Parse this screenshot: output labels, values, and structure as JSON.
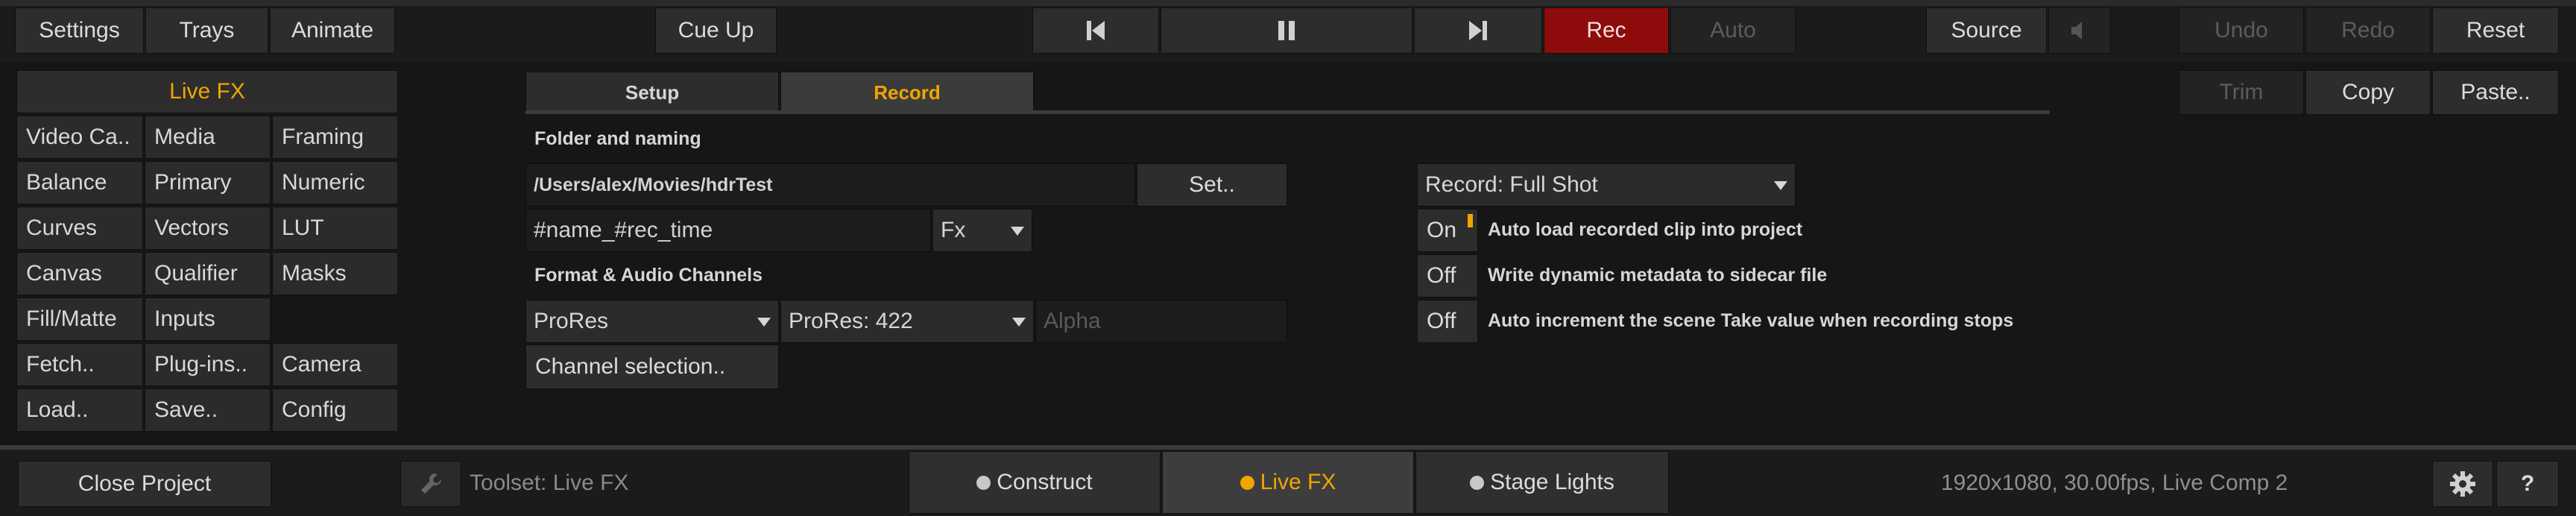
{
  "top_menu": {
    "settings": "Settings",
    "trays": "Trays",
    "animate": "Animate",
    "cue_up": "Cue Up",
    "rec": "Rec",
    "auto": "Auto",
    "source": "Source",
    "undo": "Undo",
    "redo": "Redo",
    "reset": "Reset"
  },
  "edit_buttons": {
    "trim": "Trim",
    "copy": "Copy",
    "paste": "Paste.."
  },
  "tool_grid": {
    "header": "Live FX",
    "rows": [
      [
        "Video Ca..",
        "Media",
        "Framing"
      ],
      [
        "Balance",
        "Primary",
        "Numeric"
      ],
      [
        "Curves",
        "Vectors",
        "LUT"
      ],
      [
        "Canvas",
        "Qualifier",
        "Masks"
      ],
      [
        "Fill/Matte",
        "Inputs",
        ""
      ],
      [
        "Fetch..",
        "Plug-ins..",
        "Camera"
      ],
      [
        "Load..",
        "Save..",
        "Config"
      ]
    ]
  },
  "panel": {
    "tabs": [
      "Setup",
      "Record"
    ],
    "active_tab": "Record",
    "folder_section": "Folder and naming",
    "folder_path": "/Users/alex/Movies/hdrTest",
    "set_button": "Set..",
    "naming_pattern": "#name_#rec_time",
    "naming_token": "Fx",
    "format_section": "Format & Audio Channels",
    "codec": "ProRes",
    "codec_variant": "ProRes: 422",
    "alpha_placeholder": "Alpha",
    "channel_selection": "Channel selection..",
    "record_mode": "Record: Full Shot",
    "options": [
      {
        "state": "On",
        "label": "Auto load recorded clip into project"
      },
      {
        "state": "Off",
        "label": "Write dynamic metadata to sidecar file"
      },
      {
        "state": "Off",
        "label": "Auto increment the scene Take value when recording stops"
      }
    ]
  },
  "bottom_bar": {
    "close_project": "Close Project",
    "toolset": "Toolset: Live FX",
    "modes": [
      "Construct",
      "Live FX",
      "Stage Lights"
    ],
    "active_mode": "Live FX",
    "status": "1920x1080, 30.00fps, Live Comp 2",
    "help": "?"
  },
  "colors": {
    "accent": "#f0a500",
    "rec_red": "#8e0b0b",
    "background": "#161616"
  }
}
